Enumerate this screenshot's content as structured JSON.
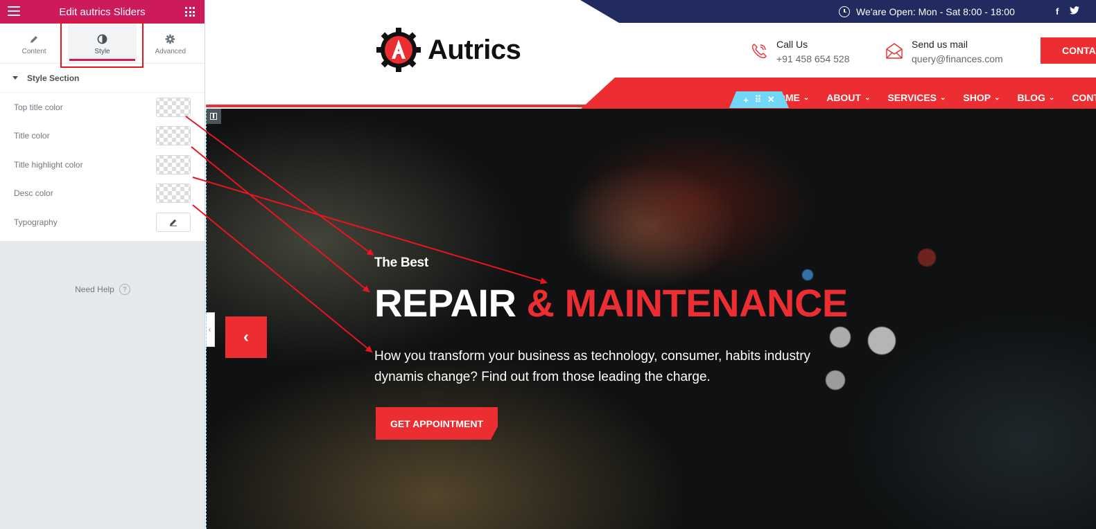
{
  "panel": {
    "title": "Edit autrics Sliders",
    "tabs": [
      {
        "label": "Content",
        "icon": "pencil-icon"
      },
      {
        "label": "Style",
        "icon": "contrast-icon"
      },
      {
        "label": "Advanced",
        "icon": "gear-icon"
      }
    ],
    "active_tab": "Style",
    "section_title": "Style Section",
    "controls": [
      {
        "label": "Top title color",
        "type": "color"
      },
      {
        "label": "Title color",
        "type": "color"
      },
      {
        "label": "Title highlight color",
        "type": "color"
      },
      {
        "label": "Desc color",
        "type": "color"
      },
      {
        "label": "Typography",
        "type": "edit"
      }
    ],
    "need_help": "Need Help",
    "help_glyph": "?"
  },
  "site": {
    "open_hours": "We'are Open: Mon - Sat 8:00 - 18:00",
    "social": [
      "f",
      "🐦"
    ],
    "logo_text": "Autrics",
    "call_label": "Call Us",
    "call_value": "+91 458 654 528",
    "mail_label": "Send us mail",
    "mail_value": "query@finances.com",
    "contact_button": "CONTA",
    "nav": [
      {
        "label": "OME"
      },
      {
        "label": "ABOUT"
      },
      {
        "label": "SERVICES"
      },
      {
        "label": "SHOP"
      },
      {
        "label": "BLOG"
      },
      {
        "label": "CONTAC"
      }
    ],
    "nav_chevron": "⌄",
    "handle_icons": [
      "+",
      "⠿",
      "✕"
    ],
    "hero": {
      "top_title": "The Best",
      "title": "REPAIR",
      "title_highlight": "& MAINTENANCE",
      "desc": "How you transform your business as technology, consumer, habits industry dynamis change? Find out from those leading the charge.",
      "button": "GET APPOINTMENT",
      "prev_glyph": "‹"
    },
    "collapse_glyph": "‹"
  },
  "colors": {
    "elementor_pink": "#cc1a5a",
    "brand_red": "#ec2d31",
    "topbar_navy": "#222b5f",
    "annotation_red": "#e8141f",
    "handle_blue": "#71d7f7"
  }
}
